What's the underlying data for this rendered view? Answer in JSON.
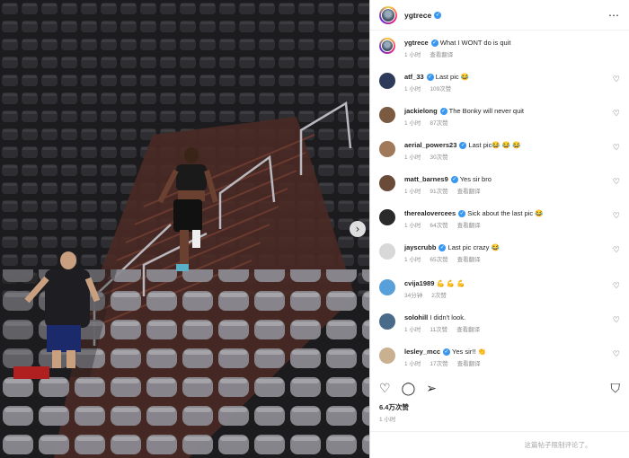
{
  "post": {
    "author": "ygtrece",
    "caption": "What I WONT do is quit",
    "caption_time": "1 小时",
    "translate_label": "查看翻译",
    "likes": "6.4万次赞",
    "posted": "1 小时",
    "comments_disabled": "这篇帖子限制评论了。"
  },
  "comments": [
    {
      "user": "atf_33",
      "text": "Last pic 😂",
      "time": "1 小时",
      "likes": "109次赞",
      "avatar_color": "#2d3a5a"
    },
    {
      "user": "jackielong",
      "text": "The Bonky will never quit",
      "time": "1 小时",
      "likes": "87次赞",
      "avatar_color": "#7a5a40"
    },
    {
      "user": "aerial_powers23",
      "text": "Last pic😂 😂 😂",
      "time": "1 小时",
      "likes": "30次赞",
      "avatar_color": "#a0785a"
    },
    {
      "user": "matt_barnes9",
      "text": "Yes sir bro",
      "time": "1 小时",
      "likes": "91次赞",
      "translate": "查看翻译",
      "avatar_color": "#6a4a38"
    },
    {
      "user": "therealovercees",
      "text": "Sick about the last pic 😂",
      "time": "1 小时",
      "likes": "64次赞",
      "translate": "查看翻译",
      "avatar_color": "#2a2a2a"
    },
    {
      "user": "jayscrubb",
      "text": "Last pic crazy 😂",
      "time": "1 小时",
      "likes": "65次赞",
      "translate": "查看翻译",
      "avatar_color": "#d8d8d8"
    },
    {
      "user": "cvija1989",
      "text": "💪 💪 💪",
      "time": "34分钟",
      "likes": "2次赞",
      "avatar_color": "#5aa0d8"
    },
    {
      "user": "solohill",
      "text": "I didn't look.",
      "time": "1 小时",
      "likes": "11次赞",
      "translate": "查看翻译",
      "avatar_color": "#4a6a8a"
    },
    {
      "user": "lesley_mcc",
      "text": "Yes sir!! 👏",
      "time": "1 小时",
      "likes": "17次赞",
      "translate": "查看翻译",
      "avatar_color": "#c8b090"
    }
  ],
  "icons": {
    "more": "⋯",
    "heart": "♡",
    "comment": "◯",
    "share": "➢",
    "save": "⛉",
    "next": "›",
    "verified": "✓"
  }
}
